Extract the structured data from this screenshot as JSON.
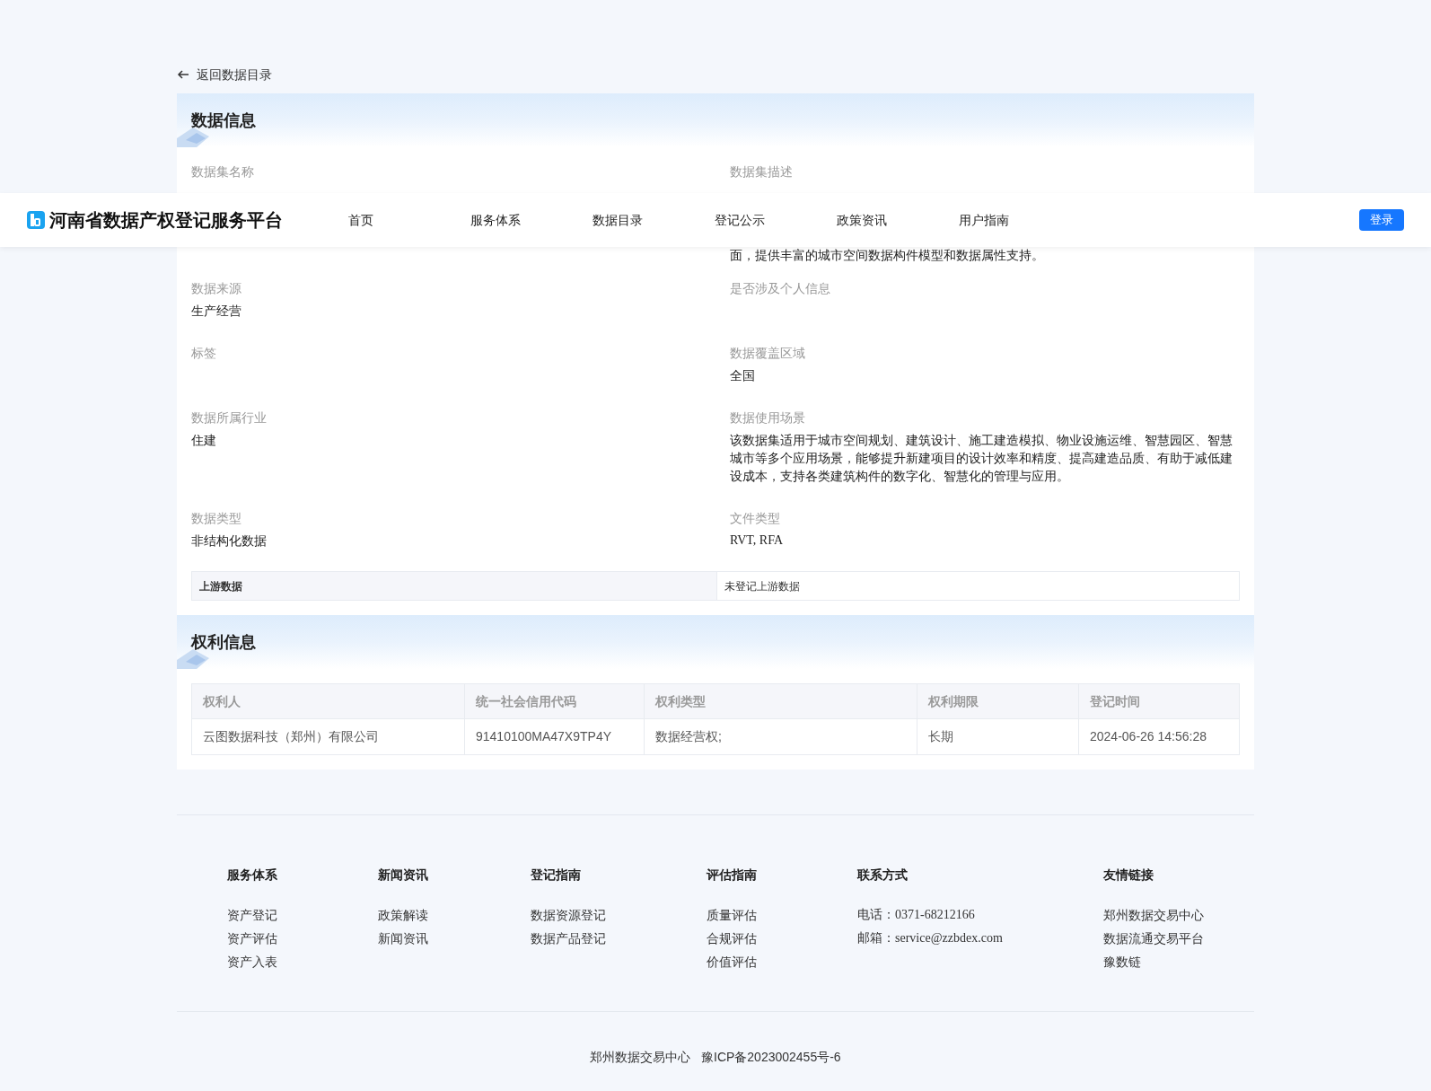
{
  "back_link": "返回数据目录",
  "header": {
    "logo_text": "河南省数据产权登记服务平台",
    "nav": [
      {
        "label": "首页"
      },
      {
        "label": "服务体系"
      },
      {
        "label": "数据目录"
      },
      {
        "label": "登记公示"
      },
      {
        "label": "政策资讯"
      },
      {
        "label": "用户指南"
      }
    ],
    "login": "登录"
  },
  "data_info": {
    "title": "数据信息",
    "fields": [
      {
        "label": "数据集名称"
      },
      {
        "label": "数据集描述"
      },
      {
        "label": "数据来源",
        "value": "生产经营"
      },
      {
        "label": "是否涉及个人信息"
      },
      {
        "label": "标签"
      },
      {
        "label": "数据覆盖区域",
        "value": "全国"
      },
      {
        "label": "数据所属行业",
        "value": "住建"
      },
      {
        "label": "数据使用场景",
        "value": "该数据集适用于城市空间规划、建筑设计、施工建造模拟、物业设施运维、智慧园区、智慧城市等多个应用场景，能够提升新建项目的设计效率和精度、提高建造品质、有助于减低建设成本，支持各类建筑构件的数字化、智慧化的管理与应用。"
      },
      {
        "label": "数据类型",
        "value": "非结构化数据"
      },
      {
        "label": "文件类型",
        "value": "RVT, RFA"
      }
    ],
    "visible_text_below_navbar": "面，提供丰富的城市空间数据构件模型和数据属性支持。",
    "upstream": {
      "label": "上游数据",
      "value": "未登记上游数据"
    }
  },
  "rights_info": {
    "title": "权利信息",
    "table": {
      "columns": [
        "权利人",
        "统一社会信用代码",
        "权利类型",
        "权利期限",
        "登记时间"
      ],
      "rows": [
        [
          "云图数据科技（郑州）有限公司",
          "91410100MA47X9TP4Y",
          "数据经营权;",
          "长期",
          "2024-06-26 14:56:28"
        ]
      ]
    }
  },
  "footer": {
    "columns": [
      {
        "title": "服务体系",
        "links": [
          "资产登记",
          "资产评估",
          "资产入表"
        ]
      },
      {
        "title": "新闻资讯",
        "links": [
          "政策解读",
          "新闻资讯"
        ]
      },
      {
        "title": "登记指南",
        "links": [
          "数据资源登记",
          "数据产品登记"
        ]
      },
      {
        "title": "评估指南",
        "links": [
          "质量评估",
          "合规评估",
          "价值评估"
        ]
      },
      {
        "title": "联系方式",
        "links": [
          "电话：0371-68212166",
          "邮箱：service@zzbdex.com"
        ]
      },
      {
        "title": "友情链接",
        "links": [
          "郑州数据交易中心",
          "数据流通交易平台",
          "豫数链"
        ]
      }
    ],
    "copyright": "郑州数据交易中心   豫ICP备2023002455号-6"
  }
}
